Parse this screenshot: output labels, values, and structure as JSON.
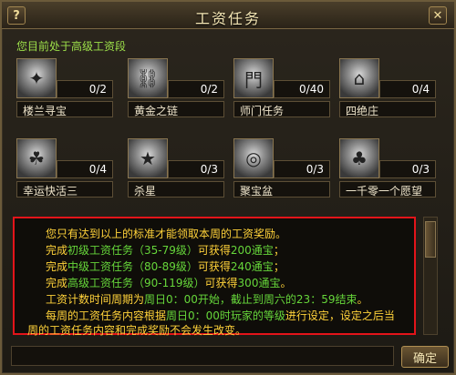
{
  "window": {
    "title": "工资任务",
    "help_label": "?",
    "close_label": "✕",
    "subtitle": "您目前处于高级工资段"
  },
  "tasks": [
    {
      "name": "楼兰寻宝",
      "count": "0/2",
      "icon": "treasure-hunt-icon"
    },
    {
      "name": "黄金之链",
      "count": "0/2",
      "icon": "golden-chain-icon"
    },
    {
      "name": "师门任务",
      "count": "0/40",
      "icon": "sect-task-icon"
    },
    {
      "name": "四绝庄",
      "count": "0/4",
      "icon": "manor-icon"
    },
    {
      "name": "幸运快活三",
      "count": "0/4",
      "icon": "lucky-icon"
    },
    {
      "name": "杀星",
      "count": "0/3",
      "icon": "star-kill-icon"
    },
    {
      "name": "聚宝盆",
      "count": "0/3",
      "icon": "treasure-bowl-icon"
    },
    {
      "name": "一千零一个愿望",
      "count": "0/3",
      "icon": "wish-tree-icon"
    }
  ],
  "info": {
    "line1": "您只有达到以上的标准才能领取本周的工资奖励。",
    "line2_a": "完成",
    "line2_b": "初级工资任务（35-79级）",
    "line2_c": "可获得",
    "line2_d": "200通宝",
    "line2_e": "；",
    "line3_a": "完成",
    "line3_b": "中级工资任务（80-89级）",
    "line3_c": "可获得",
    "line3_d": "240通宝",
    "line3_e": "；",
    "line4_a": "完成",
    "line4_b": "高级工资任务（90-119级）",
    "line4_c": "可获得",
    "line4_d": "300通宝",
    "line4_e": "。",
    "line5_a": "工资计数时间周期为",
    "line5_b": "周日0：00开始，截止到周六的23：59结束",
    "line5_c": "。",
    "line6_a": "每周的工资任务内容根据",
    "line6_b": "周日0：00时玩家的等级",
    "line6_c": "进行设定，设定之后当",
    "line7": "周的工资任务内容和完成奖励不会发生改变。"
  },
  "footer": {
    "confirm_label": "确定"
  }
}
